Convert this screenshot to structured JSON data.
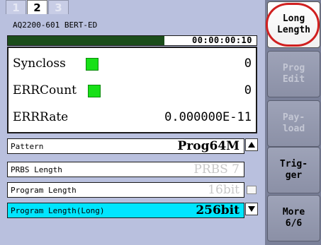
{
  "tabs": [
    {
      "label": "1",
      "state": "inactive"
    },
    {
      "label": "2",
      "state": "active"
    },
    {
      "label": "3",
      "state": "inactive"
    }
  ],
  "device": {
    "model_label": "AQ2200-601 BERT-ED"
  },
  "progress": {
    "fraction": 0.63,
    "elapsed": "00:00:00:10"
  },
  "status": {
    "syncloss": {
      "label": "Syncloss",
      "value": "0",
      "led": "green"
    },
    "errcount": {
      "label": "ERRCount",
      "value": "0",
      "led": "green"
    },
    "errrate": {
      "label": "ERRRate",
      "value": "0.000000E-11"
    }
  },
  "parameters": [
    {
      "label": "Pattern",
      "value": "Prog64M",
      "style": "normal"
    },
    {
      "label": "PRBS Length",
      "value": "PRBS 7",
      "style": "disabled"
    },
    {
      "label": "Program Length",
      "value": "16bit",
      "style": "disabled"
    },
    {
      "label": "Program Length(Long)",
      "value": "256bit",
      "style": "selected"
    }
  ],
  "softkeys": [
    {
      "label": "Long\nLength",
      "state": "active",
      "highlighted": true
    },
    {
      "label": "Prog\nEdit",
      "state": "dim"
    },
    {
      "label": "Pay-\nload",
      "state": "dim"
    },
    {
      "label": "Trig-\nger",
      "state": "normal"
    },
    {
      "label": "More\n6/6",
      "state": "normal"
    }
  ],
  "colors": {
    "background": "#b9c0de",
    "led_green": "#18e018",
    "selected_row": "#00e5ff",
    "progress_fill": "#1b4d1b",
    "highlight_ring": "#d02020"
  }
}
